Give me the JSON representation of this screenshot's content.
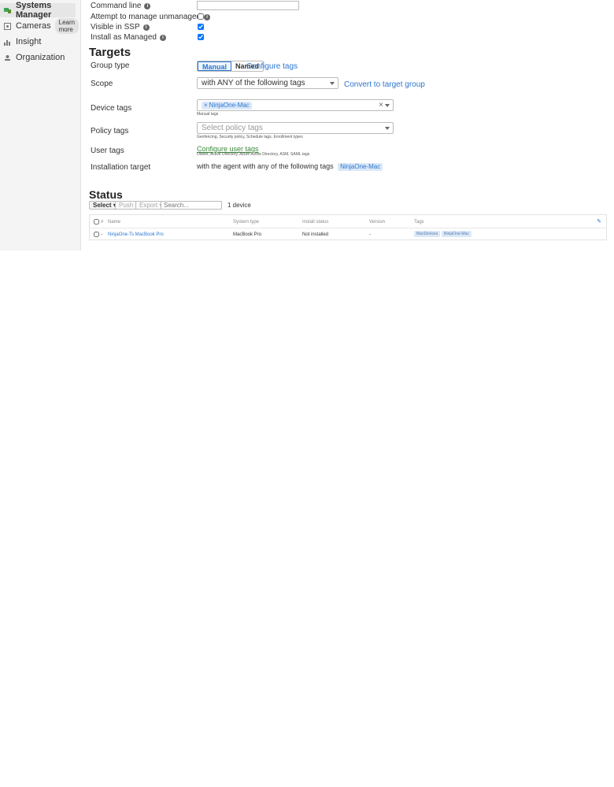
{
  "sidebar": {
    "items": [
      {
        "label": "Systems Manager",
        "icon": "systems-manager-icon"
      },
      {
        "label": "Cameras",
        "icon": "camera-icon",
        "badge": "Learn more"
      },
      {
        "label": "Insight",
        "icon": "bar-chart-icon"
      },
      {
        "label": "Organization",
        "icon": "organization-icon"
      }
    ]
  },
  "form": {
    "command_line_label": "Command line",
    "command_line_value": "",
    "attempt_manage_label": "Attempt to manage unmanaged",
    "attempt_manage_checked": false,
    "visible_ssp_label": "Visible in SSP",
    "visible_ssp_checked": true,
    "install_managed_label": "Install as Managed",
    "install_managed_checked": true
  },
  "targets": {
    "title": "Targets",
    "group_type_label": "Group type",
    "group_type_options": [
      "Manual",
      "Named"
    ],
    "configure_tags_link": "Configure tags",
    "scope_label": "Scope",
    "scope_value": "with ANY of the following tags",
    "convert_link": "Convert to target group",
    "device_tags_label": "Device tags",
    "device_tag_chip": "NinjaOne-Mac",
    "device_tags_helper": "Manual tags",
    "policy_tags_label": "Policy tags",
    "policy_tags_placeholder": "Select policy tags",
    "policy_tags_helper": "Geofencing, Security policy, Schedule tags, Enrollment types",
    "user_tags_label": "User tags",
    "user_tags_link": "Configure user tags",
    "user_tags_helper": "Owner, Active Directory, Azure Active Directory, ASM, SAML tags",
    "installation_target_label": "Installation target",
    "installation_target_text": "with the agent with any of the following tags",
    "installation_target_chip": "NinjaOne-Mac"
  },
  "status": {
    "title": "Status",
    "select_btn": "Select ▾",
    "push_btn": "Push ▾",
    "export_btn": "Export ▾",
    "search_placeholder": "Search...",
    "device_count": "1 device",
    "columns": [
      "#",
      "Name",
      "System type",
      "Install status",
      "Version",
      "Tags"
    ],
    "rows": [
      {
        "num": "-",
        "name": "NinjaOne-Ts MacBook Pro",
        "system_type": "MacBook Pro",
        "install_status": "Not installed",
        "version": "-",
        "tags": [
          "MacDevices",
          "NinjaOne-Mac"
        ]
      }
    ]
  },
  "colors": {
    "accent": "#2c76d1",
    "sidebar_bg": "#f4f4f4"
  }
}
